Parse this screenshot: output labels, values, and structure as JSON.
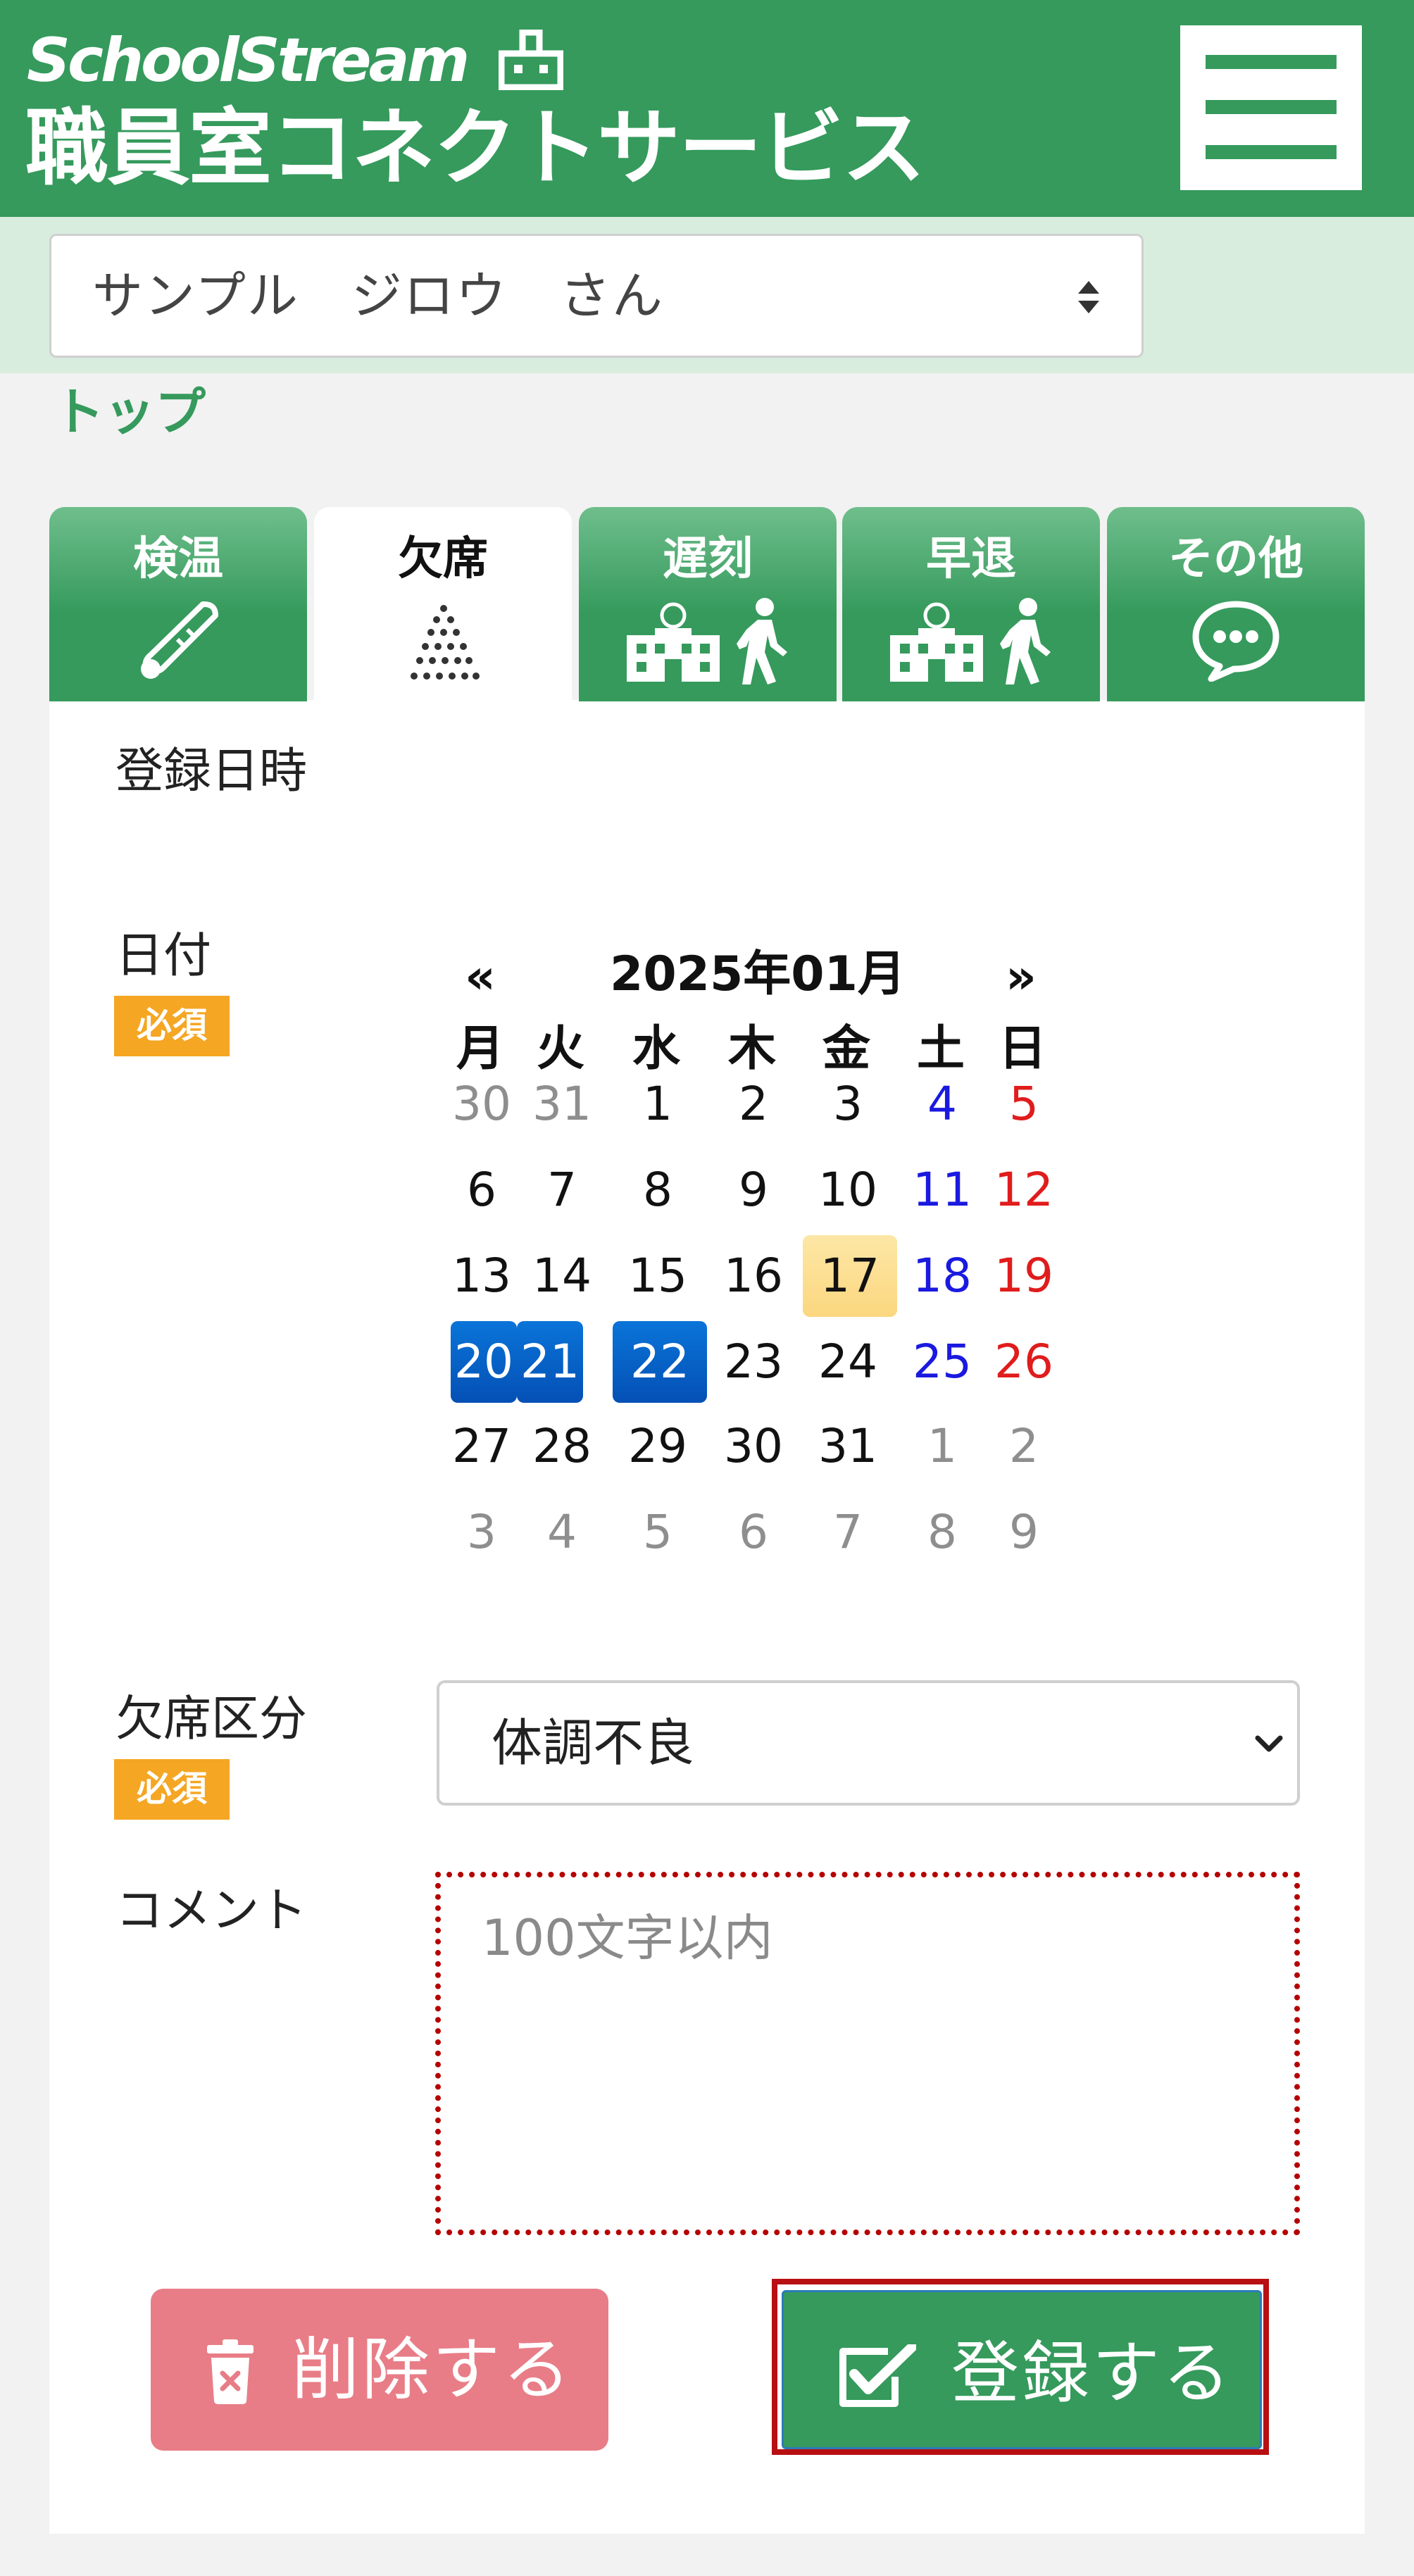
{
  "header": {
    "logo_title": "SchoolStream",
    "service_name": "職員室コネクトサービス",
    "menu_icon": "hamburger-menu-icon",
    "brand_color": "#359a5c"
  },
  "student_select": {
    "value": "サンプル　ジロウ　さん"
  },
  "breadcrumb": {
    "top": "トップ"
  },
  "tabs": [
    {
      "label": "検温",
      "icon": "thermometer-icon"
    },
    {
      "label": "欠席",
      "icon": "dots-icon",
      "active": true
    },
    {
      "label": "遅刻",
      "icon": "school-walking-icon"
    },
    {
      "label": "早退",
      "icon": "school-walking-icon"
    },
    {
      "label": "その他",
      "icon": "speech-bubble-icon"
    }
  ],
  "form": {
    "registered_at_label": "登録日時",
    "date_label": "日付",
    "required_badge": "必須",
    "reason_label": "欠席区分",
    "reason_value": "体調不良",
    "comment_label": "コメント",
    "comment_placeholder": "100文字以内"
  },
  "calendar": {
    "prev": "«",
    "next": "»",
    "month_title": "2025年01月",
    "weekdays": [
      "月",
      "火",
      "水",
      "木",
      "金",
      "土",
      "日"
    ],
    "weeks": [
      [
        "30",
        "31",
        "1",
        "2",
        "3",
        "4",
        "5"
      ],
      [
        "6",
        "7",
        "8",
        "9",
        "10",
        "11",
        "12"
      ],
      [
        "13",
        "14",
        "15",
        "16",
        "17",
        "18",
        "19"
      ],
      [
        "20",
        "21",
        "22",
        "23",
        "24",
        "25",
        "26"
      ],
      [
        "27",
        "28",
        "29",
        "30",
        "31",
        "1",
        "2"
      ],
      [
        "3",
        "4",
        "5",
        "6",
        "7",
        "8",
        "9"
      ]
    ],
    "today": "17",
    "selected": [
      "20",
      "21",
      "22"
    ]
  },
  "buttons": {
    "delete_label": "削除する",
    "delete_icon": "trash-icon",
    "register_label": "登録する",
    "register_icon": "checkbox-icon",
    "delete_color": "#e87d87",
    "register_color": "#359a5c"
  }
}
